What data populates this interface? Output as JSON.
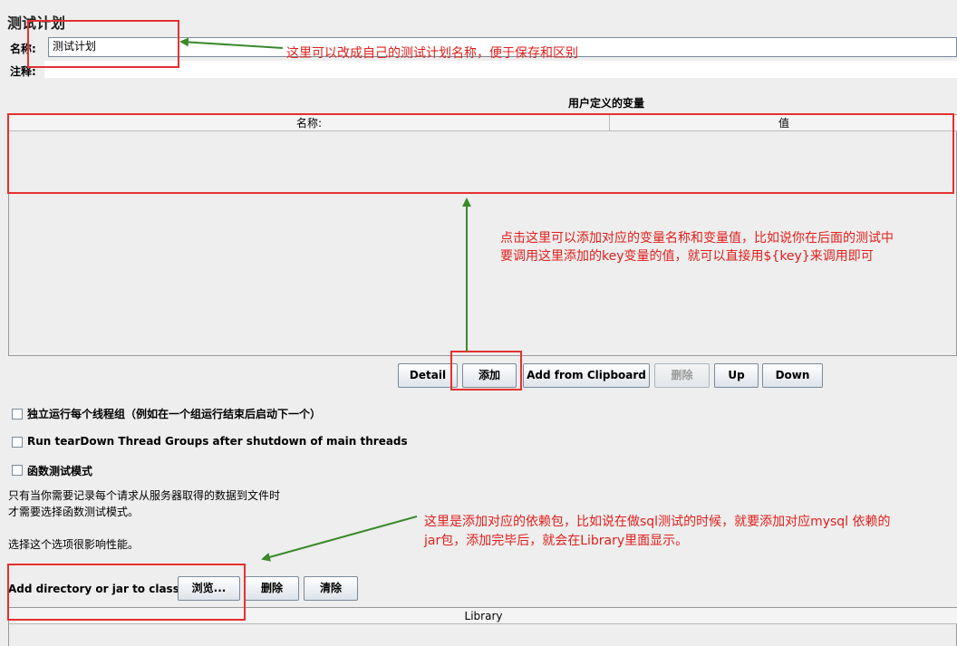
{
  "plan": {
    "title": "测试计划",
    "name_label": "名称:",
    "name_value": "测试计划",
    "comment_label": "注释:"
  },
  "variables": {
    "section_title": "用户定义的变量",
    "columns": [
      "名称:",
      "值"
    ],
    "buttons": {
      "detail": "Detail",
      "add": "添加",
      "add_clipboard": "Add from Clipboard",
      "delete": "删除",
      "up": "Up",
      "down": "Down"
    }
  },
  "options": {
    "run_thread_groups_consecutively": "独立运行每个线程组（例如在一个组运行结束后启动下一个）",
    "run_teardown": "Run tearDown Thread Groups after shutdown of main threads",
    "functional_mode": "函数测试模式",
    "functional_note_1": "只有当你需要记录每个请求从服务器取得的数据到文件时",
    "functional_note_2": "才需要选择函数测试模式。",
    "functional_note_3": "选择这个选项很影响性能。"
  },
  "classpath": {
    "label": "Add directory or jar to classpath",
    "browse": "浏览...",
    "delete": "删除",
    "clear": "清除",
    "library_header": "Library"
  },
  "annotations": {
    "name": "这里可以改成自己的测试计划名称，便于保存和区别",
    "variables_line1": "点击这里可以添加对应的变量名称和变量值，比如说你在后面的测试中",
    "variables_line2": "要调用这里添加的key变量的值，就可以直接用${key}来调用即可",
    "classpath_line1": "这里是添加对应的依赖包，比如说在做sql测试的时候，就要添加对应mysql 依赖的",
    "classpath_line2": "jar包，添加完毕后，就会在Library里面显示。"
  },
  "colors": {
    "annotation_red": "#e0201c",
    "box_red": "#e53030",
    "arrow_green": "#3a8a2a"
  }
}
